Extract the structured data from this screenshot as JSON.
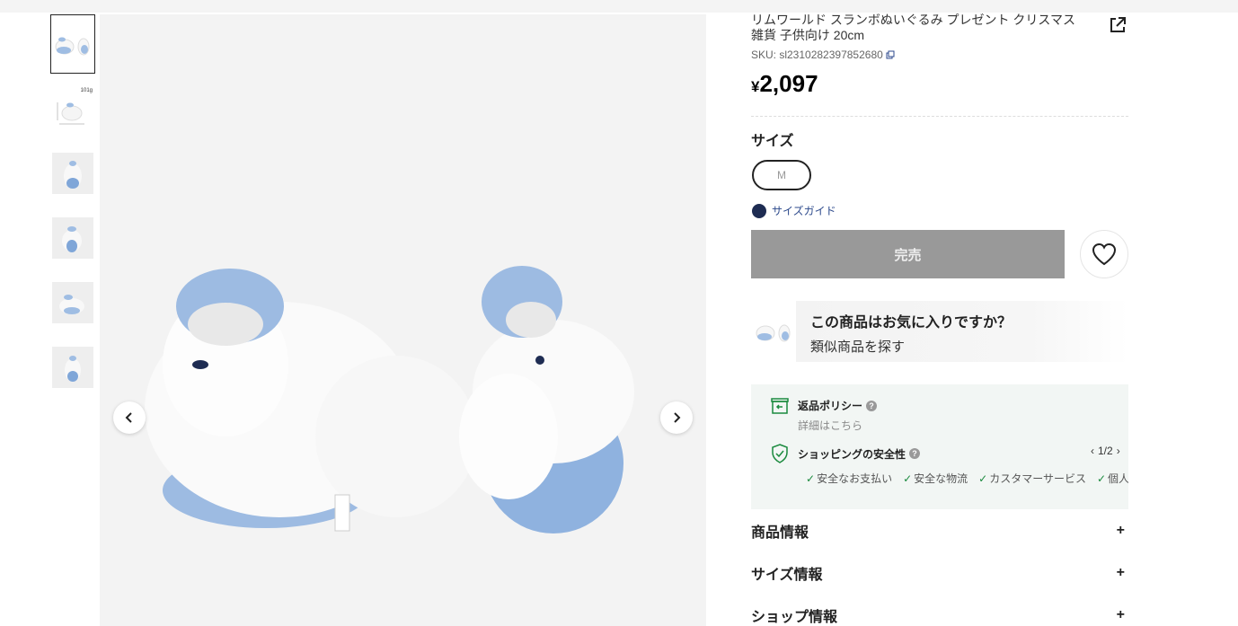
{
  "product": {
    "title": "リムワールド スランボぬいぐるみ プレゼント クリスマス 雑貨 子供向け 20cm",
    "sku": "SKU: sl2310282397852680",
    "price_symbol": "¥",
    "price": "2,097"
  },
  "thumbnails": {
    "weight_tag": "101g"
  },
  "size": {
    "label": "サイズ",
    "selected": "M",
    "guide": "サイズガイド"
  },
  "buttons": {
    "sold_out": "完売"
  },
  "promo": {
    "question": "この商品はお気に入りですか？",
    "similar": "類似商品を探す"
  },
  "policy": {
    "return_title": "返品ポリシー",
    "return_sub": "詳細はこちら",
    "safety_title": "ショッピングの安全性",
    "pager": "1/2",
    "features": [
      "安全なお支払い",
      "安全な物流",
      "カスタマーサービス",
      "個人"
    ]
  },
  "accordion": [
    {
      "label": "商品情報"
    },
    {
      "label": "サイズ情報"
    },
    {
      "label": "ショップ情報"
    }
  ],
  "colors": {
    "accent_blue": "#2d4a8c",
    "sold_out_bg": "#999999",
    "safe_green": "#1b8a3e"
  }
}
